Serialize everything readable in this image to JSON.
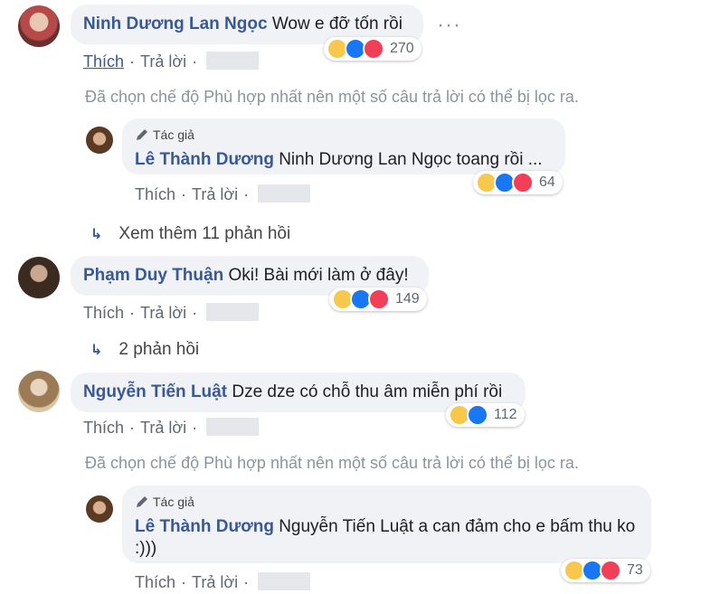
{
  "comments": [
    {
      "name": "Ninh Dương Lan Ngọc",
      "text": "Wow e đỡ tốn rồi",
      "like": "Thích",
      "reply": "Trả lời",
      "reactions": "270"
    },
    {
      "author_badge": "Tác giả",
      "name": "Lê Thành Dương",
      "mention": "Ninh Dương Lan Ngọc",
      "text": "toang rồi ...",
      "like": "Thích",
      "reply": "Trả lời",
      "reactions": "64"
    },
    {
      "name": "Phạm Duy Thuận",
      "text": "Oki! Bài mới làm ở đây!",
      "like": "Thích",
      "reply": "Trả lời",
      "reactions": "149"
    },
    {
      "name": "Nguyễn Tiến Luật",
      "text": "Dze dze có chỗ thu âm miễn phí rồi",
      "like": "Thích",
      "reply": "Trả lời",
      "reactions": "112"
    },
    {
      "author_badge": "Tác giả",
      "name": "Lê Thành Dương",
      "mention": "Nguyễn Tiến Luật",
      "text": "a can đảm cho e bấm thu ko :)))",
      "like": "Thích",
      "reply": "Trả lời",
      "reactions": "73"
    }
  ],
  "filter_note": "Đã chọn chế độ Phù hợp nhất nên một số câu trả lời có thể bị lọc ra.",
  "view_more_1": "Xem thêm 11 phản hồi",
  "view_more_2": "2 phản hồi",
  "colors": {
    "name": "#385898",
    "bubble": "#f0f2f5",
    "meta": "#606770"
  },
  "icons": [
    "more-options-icon",
    "pen-icon",
    "haha-icon",
    "like-icon",
    "love-icon",
    "reply-arrow-icon"
  ]
}
